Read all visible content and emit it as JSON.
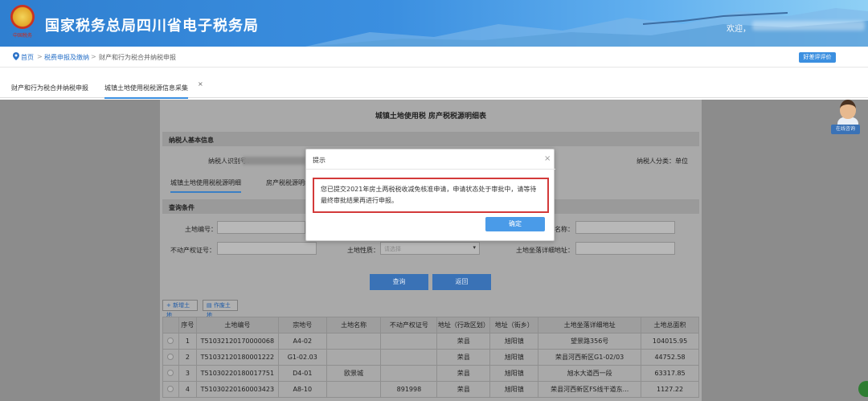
{
  "header": {
    "emblem_text": "中国税务",
    "title": "国家税务总局四川省电子税务局",
    "welcome": "欢迎，"
  },
  "breadcrumb": {
    "home": "首页",
    "sep1": ">",
    "level1": "税费申报及缴纳",
    "sep2": ">",
    "level2": "财产和行为税合并纳税申报",
    "eval_button": "好差评评价"
  },
  "tabs": [
    {
      "label": "财产和行为税合并纳税申报"
    },
    {
      "label": "城镇土地使用税税源信息采集"
    }
  ],
  "tab_close": "×",
  "form": {
    "title": "城镇土地使用税  房产税税源明细表",
    "basic_info_header": "纳税人基本信息",
    "taxpayer_id_label": "纳税人识别号：",
    "taxpayer_type_label": "纳税人分类：单位",
    "subtabs": [
      "城镇土地使用税税源明细",
      "房产税税源明细"
    ],
    "query_header": "查询条件",
    "land_no_label": "土地编号：",
    "land_name_label": "名称：",
    "property_cert_label": "不动产权证号：",
    "land_nature_label": "土地性质：",
    "land_nature_placeholder": "请选择",
    "land_address_label": "土地坐落详细地址：",
    "query_button": "查询",
    "return_button": "返回",
    "add_land_button": "新增土地",
    "void_land_button": "作废土地"
  },
  "table": {
    "headers": [
      "",
      "序号",
      "土地编号",
      "宗地号",
      "土地名称",
      "不动产权证号",
      "地址（行政区划）",
      "地址（街乡）",
      "土地坐落详细地址",
      "土地总面积"
    ],
    "rows": [
      [
        "",
        "1",
        "T51032120170000068",
        "A4-02",
        "",
        "",
        "荣县",
        "旭阳镇",
        "望景路356号",
        "104015.95"
      ],
      [
        "",
        "2",
        "T51032120180001222",
        "G1-02.03",
        "",
        "",
        "荣县",
        "旭阳镇",
        "荣县河西新区G1-02/03",
        "44752.58"
      ],
      [
        "",
        "3",
        "T51030220180017751",
        "D4-01",
        "欧景城",
        "",
        "荣县",
        "旭阳镇",
        "旭水大道西一段",
        "63317.85"
      ],
      [
        "",
        "4",
        "T51030220160003423",
        "A8-10",
        "",
        "891998",
        "荣县",
        "旭阳镇",
        "荣县河西新区FS线干道东...",
        "1127.22"
      ]
    ]
  },
  "helper_label": "在线咨询",
  "modal": {
    "title": "提示",
    "close": "×",
    "message": "您已提交2021年房土两税税收减免核准申请，申请状态处于审批中，请等待最终审批结果再进行申报。",
    "ok_button": "确定"
  },
  "colors": {
    "accent": "#3b8fe0",
    "highlight_border": "#d33a3a",
    "overlay": "#8c8c8c"
  }
}
